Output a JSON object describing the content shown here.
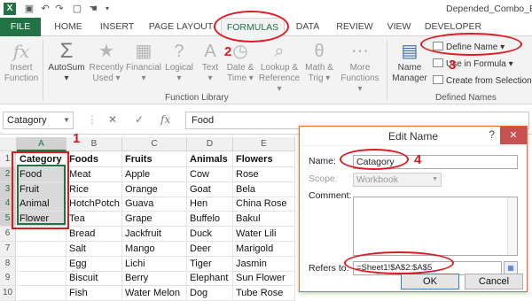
{
  "window": {
    "title": "Depended_Combo_By_M",
    "app_icon_label": "X",
    "qat_icons": [
      "save-icon",
      "undo-icon",
      "redo-icon",
      "print-preview-icon",
      "touch-mode-icon",
      "customize-qat-icon"
    ]
  },
  "tabs": [
    "FILE",
    "HOME",
    "INSERT",
    "PAGE LAYOUT",
    "FORMULAS",
    "DATA",
    "REVIEW",
    "VIEW",
    "DEVELOPER"
  ],
  "ribbon": {
    "buttons": [
      {
        "line1": "Insert",
        "line2": "Function",
        "icon": "fx"
      },
      {
        "line1": "AutoSum",
        "line2": "▾",
        "icon": "Σ"
      },
      {
        "line1": "Recently",
        "line2": "Used ▾",
        "icon": "★"
      },
      {
        "line1": "Financial",
        "line2": "▾",
        "icon": "▦"
      },
      {
        "line1": "Logical",
        "line2": "▾",
        "icon": "?"
      },
      {
        "line1": "Text",
        "line2": "▾",
        "icon": "A"
      },
      {
        "line1": "Date &",
        "line2": "Time ▾",
        "icon": "◷"
      },
      {
        "line1": "Lookup &",
        "line2": "Reference ▾",
        "icon": "⌕"
      },
      {
        "line1": "Math &",
        "line2": "Trig ▾",
        "icon": "θ"
      },
      {
        "line1": "More",
        "line2": "Functions ▾",
        "icon": "⋯"
      },
      {
        "line1": "Name",
        "line2": "Manager",
        "icon": "▤"
      }
    ],
    "group_function_library": "Function Library",
    "define_name": "Define Name ▾",
    "use_in_formula": "Use in Formula ▾",
    "create_from_selection": "Create from Selection",
    "group_defined_names": "Defined Names"
  },
  "formula_bar": {
    "name_box": "Catagory",
    "cancel": "✕",
    "enter": "✓",
    "fx": "fx",
    "content": "Food"
  },
  "sheet": {
    "columns": [
      "A",
      "B",
      "C",
      "D",
      "E"
    ],
    "rows": [
      [
        "Category",
        "Foods",
        "Fruits",
        "Animals",
        "Flowers"
      ],
      [
        "Food",
        "Meat",
        "Apple",
        "Cow",
        "Rose"
      ],
      [
        "Fruit",
        "Rice",
        "Orange",
        "Goat",
        "Bela"
      ],
      [
        "Animal",
        "HotchPotch",
        "Guava",
        "Hen",
        "China Rose"
      ],
      [
        "Flower",
        "Tea",
        "Grape",
        "Buffelo",
        "Bakul"
      ],
      [
        "",
        "Bread",
        "Jackfruit",
        "Duck",
        "Water Lili"
      ],
      [
        "",
        "Salt",
        "Mango",
        "Deer",
        "Marigold"
      ],
      [
        "",
        "Egg",
        "Lichi",
        "Tiger",
        "Jasmin"
      ],
      [
        "",
        "Biscuit",
        "Berry",
        "Elephant",
        "Sun Flower"
      ],
      [
        "",
        "Fish",
        "Water Melon",
        "Dog",
        "Tube Rose"
      ]
    ],
    "row_numbers": [
      "1",
      "2",
      "3",
      "4",
      "5",
      "6",
      "7",
      "8",
      "9",
      "10"
    ]
  },
  "dialog": {
    "title": "Edit Name",
    "help": "?",
    "close": "✕",
    "name_label": "Name:",
    "name_value": "Catagory",
    "scope_label": "Scope:",
    "scope_value": "Workbook",
    "comment_label": "Comment:",
    "refers_label": "Refers to:",
    "refers_value": "=Sheet1!$A$2:$A$5",
    "ok": "OK",
    "cancel": "Cancel"
  },
  "annotations": {
    "step1": "1",
    "step2": "2",
    "step3": "3",
    "step4": "4",
    "color": "#e0191f"
  }
}
